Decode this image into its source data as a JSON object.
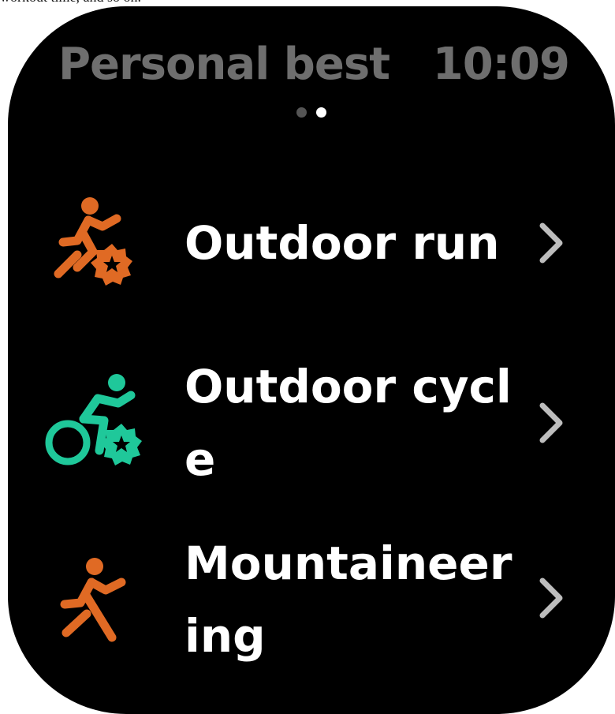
{
  "header": {
    "title": "Personal best",
    "time": "10:09"
  },
  "caption": {
    "fragment": "workout time, and so on."
  },
  "pager": {
    "pages": 2,
    "current": 2
  },
  "items": [
    {
      "label": "Outdoor run",
      "icon": "running-person-badge-icon",
      "color": "#e06a24"
    },
    {
      "label": "Outdoor cycle",
      "icon": "cycling-person-badge-icon",
      "color": "#1fc89a"
    },
    {
      "label": "Mountaineering",
      "icon": "running-person-icon",
      "color": "#e06a24"
    }
  ],
  "colors": {
    "background": "#000000",
    "header_text": "#6e6e6e",
    "chevron": "#bdbdbd"
  }
}
